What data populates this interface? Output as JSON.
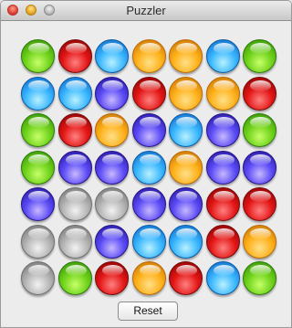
{
  "window": {
    "title": "Puzzler"
  },
  "colors": {
    "green": "#6fd21b",
    "red": "#e31616",
    "blue": "#3ab7ff",
    "orange": "#ffb11a",
    "purple": "#5a4af5",
    "gray": "#b5b5b5"
  },
  "board": {
    "rows": [
      [
        "green",
        "red",
        "blue",
        "orange",
        "orange",
        "blue",
        "green"
      ],
      [
        "blue",
        "blue",
        "purple",
        "red",
        "orange",
        "orange",
        "red"
      ],
      [
        "green",
        "red",
        "orange",
        "purple",
        "blue",
        "purple",
        "green"
      ],
      [
        "green",
        "purple",
        "purple",
        "blue",
        "orange",
        "purple",
        "purple"
      ],
      [
        "purple",
        "gray",
        "gray",
        "purple",
        "purple",
        "red",
        "red"
      ],
      [
        "gray",
        "gray",
        "purple",
        "blue",
        "blue",
        "red",
        "orange"
      ],
      [
        "gray",
        "green",
        "red",
        "orange",
        "red",
        "blue",
        "green"
      ]
    ]
  },
  "controls": {
    "reset_label": "Reset"
  }
}
